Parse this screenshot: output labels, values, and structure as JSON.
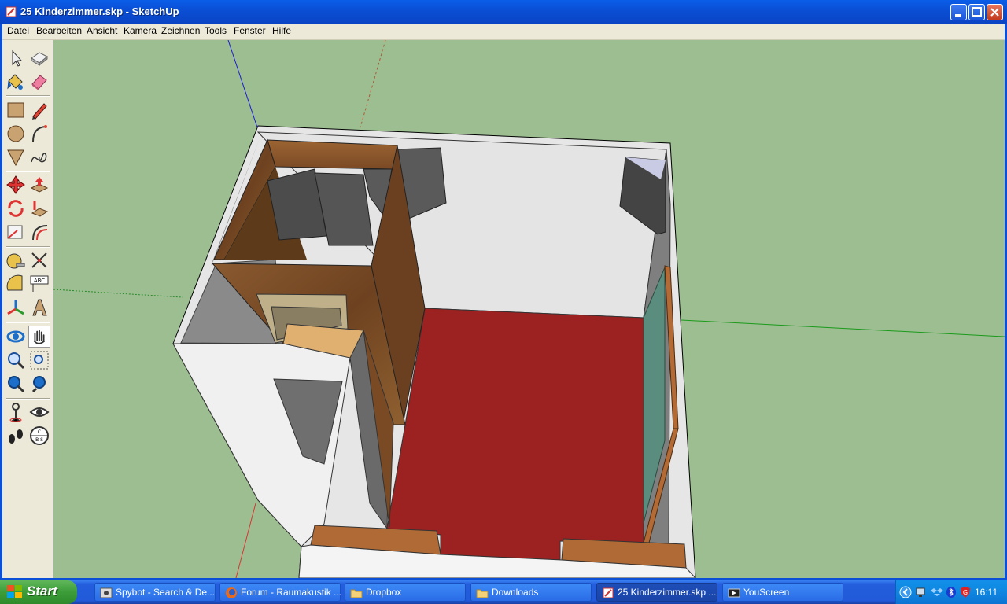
{
  "window": {
    "title": "25 Kinderzimmer.skp - SketchUp"
  },
  "menubar": {
    "items": [
      "Datei",
      "Bearbeiten",
      "Ansicht",
      "Kamera",
      "Zeichnen",
      "Tools",
      "Fenster",
      "Hilfe"
    ]
  },
  "toolbar": {
    "tools": [
      "select-icon",
      "component-icon",
      "paint-bucket-icon",
      "eraser-icon",
      "rectangle-icon",
      "pencil-icon",
      "circle-icon",
      "arc-icon",
      "polygon-icon",
      "freehand-icon",
      "move-icon",
      "push-pull-icon",
      "rotate-icon",
      "follow-me-icon",
      "scale-icon",
      "offset-icon",
      "tape-measure-icon",
      "dimension-icon",
      "protractor-icon",
      "text-icon",
      "axes-icon",
      "3d-text-icon",
      "orbit-icon",
      "pan-icon",
      "zoom-icon",
      "zoom-window-icon",
      "zoom-extents-icon",
      "previous-view-icon",
      "position-camera-icon",
      "look-around-icon",
      "walk-icon",
      "section-plane-icon"
    ],
    "text_tool_label": "ABC"
  },
  "colors": {
    "viewport_background": "#9cbe91",
    "floor_red": "#9c2121",
    "wall_white": "#efefef",
    "wood_brown": "#7a4a25",
    "glass_teal": "#5a8d7d"
  },
  "taskbar": {
    "start_label": "Start",
    "tasks": [
      {
        "label": "Spybot - Search & De...",
        "icon": "spybot-icon"
      },
      {
        "label": "Forum - Raumakustik ...",
        "icon": "firefox-icon"
      },
      {
        "label": "Dropbox",
        "icon": "folder-icon"
      },
      {
        "label": "Downloads",
        "icon": "folder-icon"
      },
      {
        "label": "25 Kinderzimmer.skp ...",
        "icon": "sketchup-icon",
        "active": true
      },
      {
        "label": "YouScreen",
        "icon": "youscreen-icon"
      }
    ],
    "clock": "16:11"
  }
}
